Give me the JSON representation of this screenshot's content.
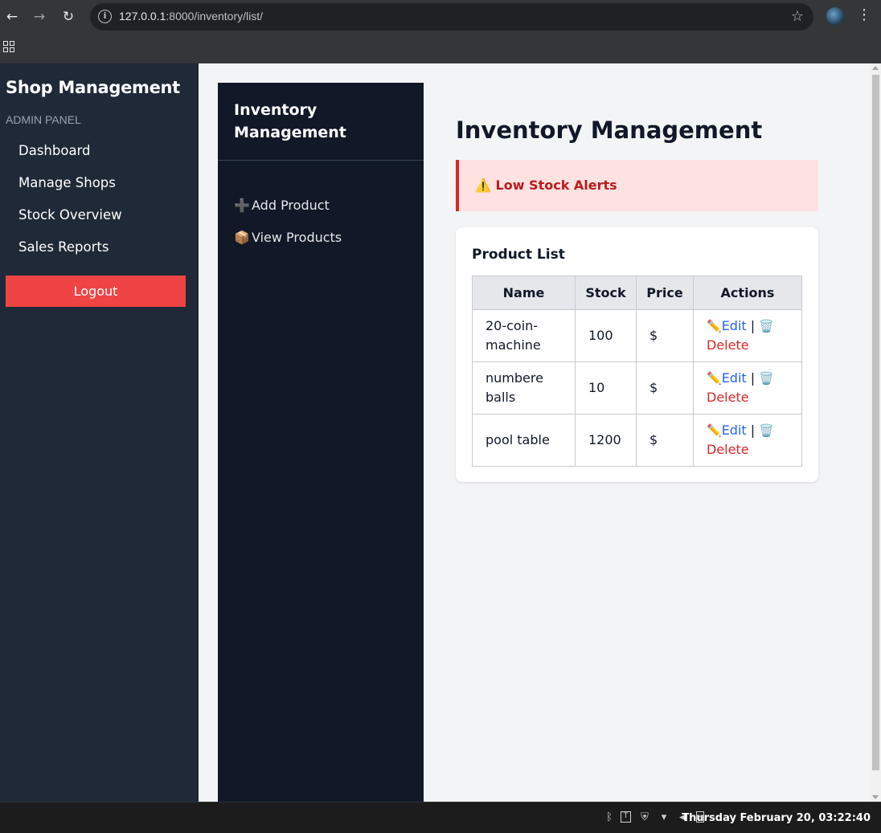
{
  "browser": {
    "url_host": "127.0.0.1",
    "url_rest": ":8000/inventory/list/",
    "back_icon": "←",
    "forward_icon": "→",
    "reload_icon": "↻",
    "star_icon": "☆",
    "menu_icon": "⋮",
    "info_icon": "i"
  },
  "sidebar": {
    "brand": "Shop Management",
    "section_label": "ADMIN PANEL",
    "items": [
      {
        "label": "Dashboard"
      },
      {
        "label": "Manage Shops"
      },
      {
        "label": "Stock Overview"
      },
      {
        "label": "Sales Reports"
      }
    ],
    "logout_label": "Logout"
  },
  "inventory_nav": {
    "title": "Inventory Management",
    "links": [
      {
        "icon": "➕",
        "label": "Add Product"
      },
      {
        "icon": "📦",
        "label": "View Products"
      }
    ]
  },
  "main": {
    "page_title": "Inventory Management",
    "alert": {
      "icon": "⚠️",
      "text": "Low Stock Alerts"
    },
    "product_list": {
      "title": "Product List",
      "columns": [
        "Name",
        "Stock",
        "Price",
        "Actions"
      ],
      "rows": [
        {
          "name": "20-coin-machine",
          "stock": "100",
          "price": "$"
        },
        {
          "name": "numbere balls",
          "stock": "10",
          "price": "$"
        },
        {
          "name": "pool table",
          "stock": "1200",
          "price": "$"
        }
      ],
      "edit_icon": "✏️",
      "edit_label": "Edit",
      "separator": "|",
      "delete_icon": "🗑️",
      "delete_label": "Delete"
    }
  },
  "taskbar": {
    "clock": "Thursday February 20, 03:22:40"
  },
  "colors": {
    "sidebar_bg": "#1f2937",
    "inventory_nav_bg": "#111827",
    "logout_bg": "#ef4444",
    "alert_bg": "#fee2e2",
    "alert_text": "#b91c1c",
    "edit_link": "#2563eb",
    "delete_link": "#dc2626"
  }
}
